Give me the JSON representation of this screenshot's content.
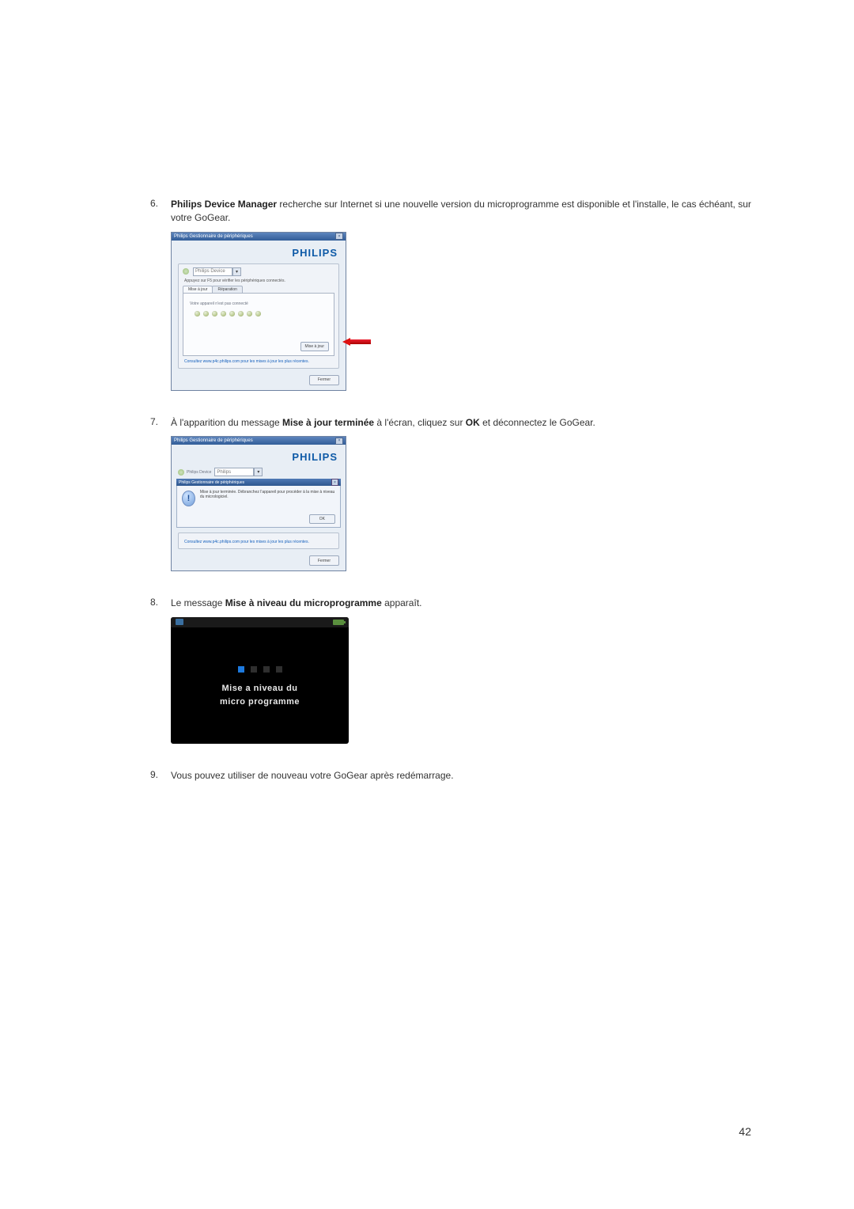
{
  "brand": "PHILIPS",
  "page_number": "42",
  "steps": [
    {
      "num": "6.",
      "segments": [
        {
          "bold": true,
          "text": "Philips Device Manager"
        },
        {
          "bold": false,
          "text": " recherche sur Internet si une nouvelle version du microprogramme est disponible et l'installe, le cas échéant, sur votre GoGear."
        }
      ]
    },
    {
      "num": "7.",
      "segments": [
        {
          "bold": false,
          "text": "À l'apparition du message "
        },
        {
          "bold": true,
          "text": "Mise à jour terminée"
        },
        {
          "bold": false,
          "text": " à l'écran, cliquez sur "
        },
        {
          "bold": true,
          "text": "OK"
        },
        {
          "bold": false,
          "text": " et déconnectez le GoGear."
        }
      ]
    },
    {
      "num": "8.",
      "segments": [
        {
          "bold": false,
          "text": "Le message "
        },
        {
          "bold": true,
          "text": "Mise à niveau du microprogramme"
        },
        {
          "bold": false,
          "text": " apparaît."
        }
      ]
    },
    {
      "num": "9.",
      "segments": [
        {
          "bold": false,
          "text": "Vous pouvez utiliser de nouveau votre GoGear après redémarrage."
        }
      ]
    }
  ],
  "fig1": {
    "window_title": "Philips Gestionnaire de périphériques",
    "device_label": "Philips Device",
    "help_text": "Appuyez sur F5 pour vérifier les périphériques connectés.",
    "tab_update": "Mise à jour",
    "tab_repair": "Réparation",
    "status": "Votre appareil n'est pas connecté",
    "update_button": "Mise à jour",
    "link_text": "Consultez www.p4c.philips.com pour les mises à jour les plus récentes.",
    "close_button": "Fermer"
  },
  "fig2": {
    "window_title": "Philips Gestionnaire de périphériques",
    "device_value": "Philips",
    "popup_title": "Philips Gestionnaire de périphériques",
    "popup_message": "Mise à jour terminée. Débranchez l'appareil pour procéder à la mise à niveau du micrologiciel.",
    "ok_button": "OK",
    "link_text": "Consultez www.p4c.philips.com pour les mises à jour les plus récentes.",
    "close_button": "Fermer"
  },
  "fig3": {
    "line1": "Mise a niveau du",
    "line2": "micro programme"
  }
}
